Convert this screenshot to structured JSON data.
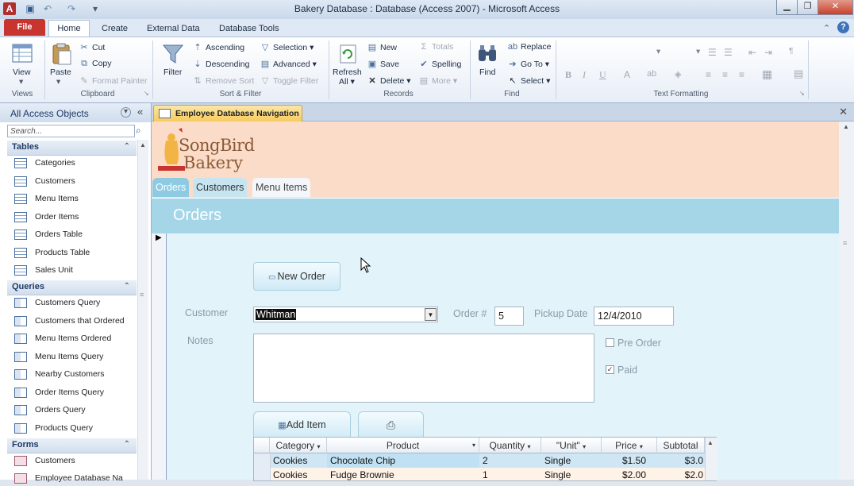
{
  "window": {
    "title": "Bakery Database : Database (Access 2007)  -  Microsoft Access",
    "app_icon_letter": "A"
  },
  "ribbon_tabs": [
    {
      "label": "File"
    },
    {
      "label": "Home"
    },
    {
      "label": "Create"
    },
    {
      "label": "External Data"
    },
    {
      "label": "Database Tools"
    }
  ],
  "ribbon": {
    "views": {
      "view_label": "View",
      "group": "Views"
    },
    "clipboard": {
      "paste": "Paste",
      "cut": "Cut",
      "copy": "Copy",
      "format_painter": "Format Painter",
      "group": "Clipboard"
    },
    "sort_filter": {
      "filter": "Filter",
      "ascending": "Ascending",
      "descending": "Descending",
      "remove_sort": "Remove Sort",
      "selection": "Selection",
      "advanced": "Advanced",
      "toggle_filter": "Toggle Filter",
      "group": "Sort & Filter"
    },
    "records": {
      "refresh": "Refresh",
      "refresh_sub": "All",
      "new": "New",
      "save": "Save",
      "delete": "Delete",
      "totals": "Totals",
      "spelling": "Spelling",
      "more": "More",
      "group": "Records"
    },
    "find": {
      "find": "Find",
      "replace": "Replace",
      "goto": "Go To",
      "select": "Select",
      "group": "Find"
    },
    "text_formatting": {
      "bold": "B",
      "italic": "I",
      "underline": "U",
      "group": "Text Formatting"
    }
  },
  "nav_pane": {
    "title": "All Access Objects",
    "search_placeholder": "Search...",
    "sections": [
      {
        "title": "Tables",
        "items": [
          "Categories",
          "Customers",
          "Menu Items",
          "Order Items",
          "Orders Table",
          "Products Table",
          "Sales Unit"
        ]
      },
      {
        "title": "Queries",
        "items": [
          "Customers Query",
          "Customers that Ordered",
          "Menu Items Ordered",
          "Menu Items Query",
          "Nearby Customers",
          "Order Items Query",
          "Orders Query",
          "Products Query"
        ]
      },
      {
        "title": "Forms",
        "items": [
          "Customers",
          "Employee Database Na"
        ]
      }
    ]
  },
  "document": {
    "tab_label": "Employee Database Navigation",
    "logo_line1": "SongBird",
    "logo_line2": "Bakery",
    "nav_tabs": [
      "Orders",
      "Customers",
      "Menu Items"
    ],
    "section_title": "Orders",
    "new_order_button": "New Order",
    "customer_label": "Customer",
    "customer_value": "Whitman",
    "order_num_label": "Order #",
    "order_num_value": "5",
    "pickup_label": "Pickup Date",
    "pickup_value": "12/4/2010",
    "notes_label": "Notes",
    "pre_order_label": "Pre Order",
    "pre_order_checked": false,
    "paid_label": "Paid",
    "paid_checked": true,
    "add_item_button": "Add Item",
    "subform": {
      "columns": [
        "Category",
        "Product",
        "Quantity",
        "\"Unit\"",
        "Price",
        "Subtotal"
      ],
      "rows": [
        {
          "category": "Cookies",
          "product": "Chocolate Chip",
          "quantity": "2",
          "unit": "Single",
          "price": "$1.50",
          "subtotal": "$3.0"
        },
        {
          "category": "Cookies",
          "product": "Fudge Brownie",
          "quantity": "1",
          "unit": "Single",
          "price": "$2.00",
          "subtotal": "$2.0"
        }
      ]
    }
  },
  "colors": {
    "file_tab": "#c8352f",
    "banner": "#fbdcc8",
    "orders_header": "#a5d6e8",
    "form_body": "#e2f3fa",
    "selected_row": "#cfe7f5"
  }
}
